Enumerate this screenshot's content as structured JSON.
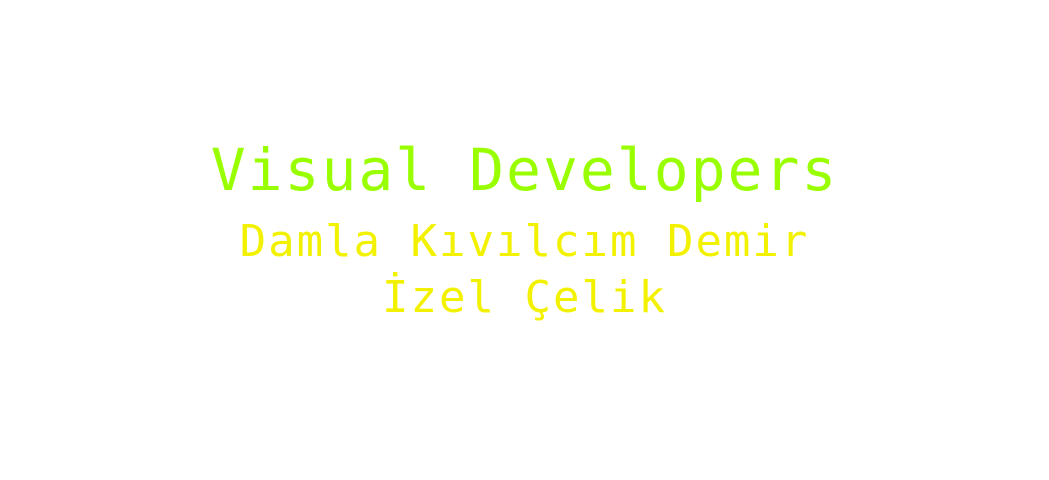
{
  "title": "Visual Developers",
  "names": [
    "Damla Kıvılcım Demir",
    "İzel Çelik"
  ],
  "colors": {
    "title": "#99ff00",
    "names": "#f2f200",
    "background": "#ffffff"
  }
}
